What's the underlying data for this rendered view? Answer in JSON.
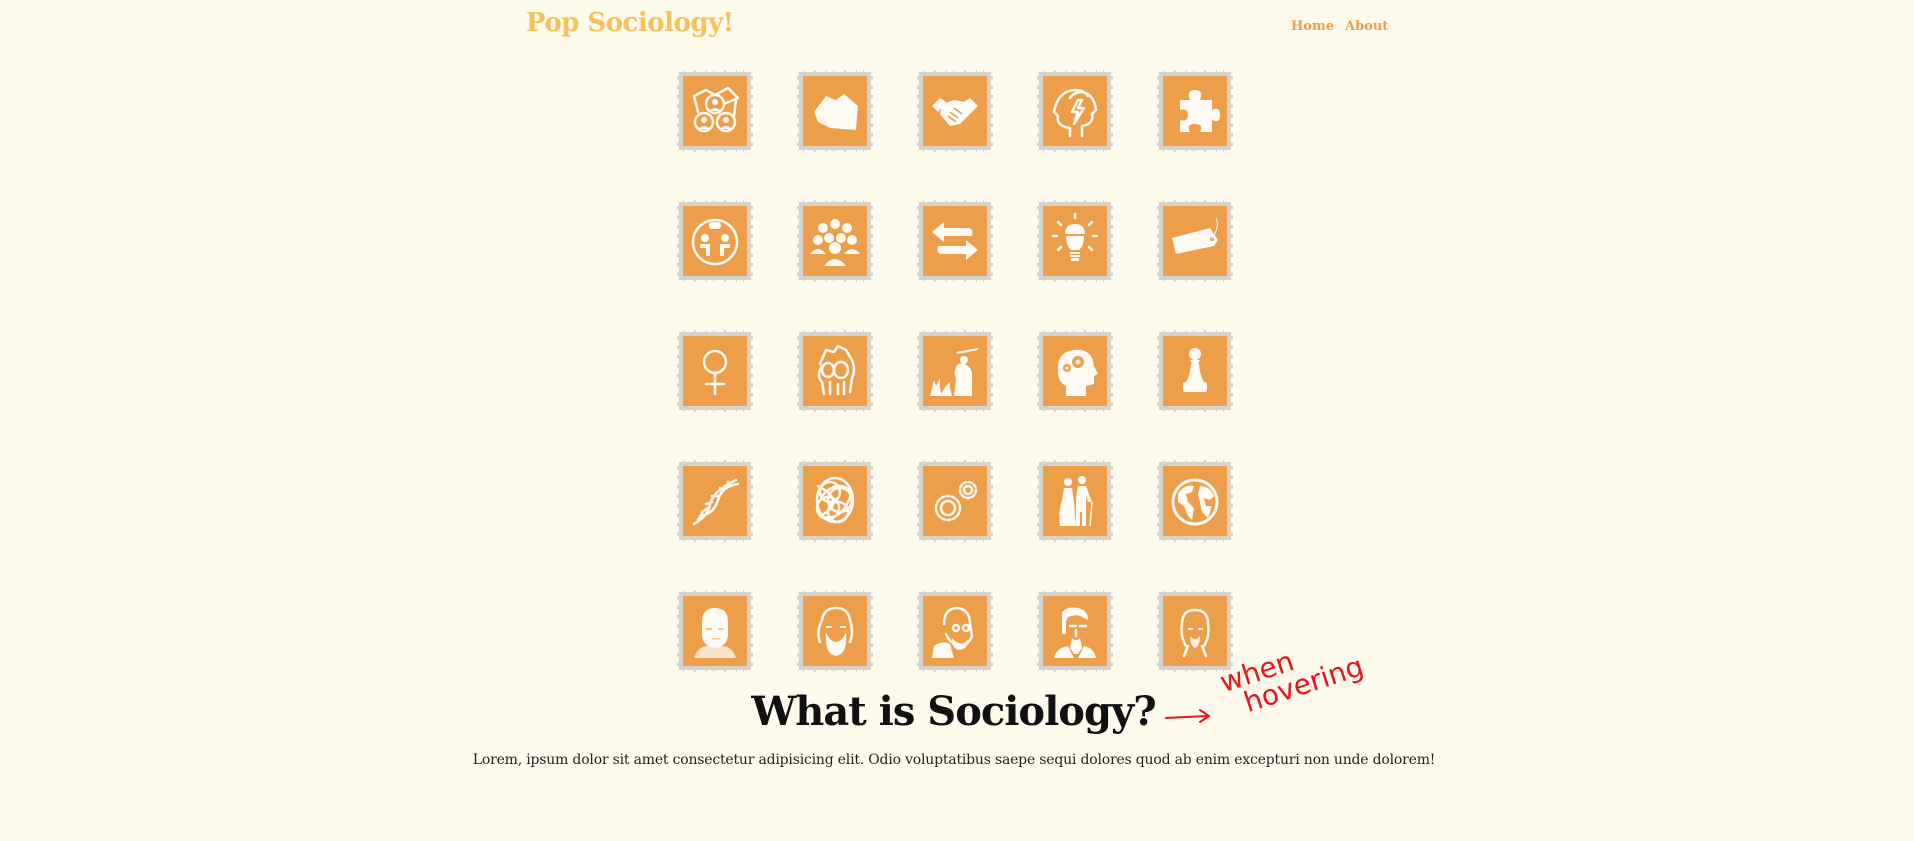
{
  "header": {
    "brand": "Pop Sociology!",
    "nav": [
      {
        "label": "Home"
      },
      {
        "label": "About"
      }
    ]
  },
  "colors": {
    "background": "#fefbec",
    "brand": "#f4c15a",
    "nav_link": "#ec9e4e",
    "stamp_face": "#ec9e4b",
    "stamp_border": "#d6d3cc",
    "annotation": "#e8151b"
  },
  "stamps": [
    {
      "icon": "social-network-icon"
    },
    {
      "icon": "crumpled-paper-icon"
    },
    {
      "icon": "handshake-icon"
    },
    {
      "icon": "head-lightning-icon"
    },
    {
      "icon": "puzzle-piece-icon"
    },
    {
      "icon": "conversation-icon"
    },
    {
      "icon": "crowd-icon"
    },
    {
      "icon": "exchange-arrows-icon"
    },
    {
      "icon": "brain-lightbulb-icon"
    },
    {
      "icon": "price-tag-icon"
    },
    {
      "icon": "venus-symbol-icon"
    },
    {
      "icon": "raised-fist-icon"
    },
    {
      "icon": "police-baton-icon"
    },
    {
      "icon": "head-gears-icon"
    },
    {
      "icon": "chess-pawn-icon"
    },
    {
      "icon": "dna-helix-icon"
    },
    {
      "icon": "tangled-scribble-icon"
    },
    {
      "icon": "gears-icon"
    },
    {
      "icon": "elderly-couple-icon"
    },
    {
      "icon": "globe-icon"
    },
    {
      "icon": "portrait-comte-icon"
    },
    {
      "icon": "portrait-marx-icon"
    },
    {
      "icon": "portrait-durkheim-icon"
    },
    {
      "icon": "portrait-weber-icon"
    },
    {
      "icon": "portrait-spencer-icon"
    }
  ],
  "main": {
    "heading": "What is Sociology?",
    "lead": "Lorem, ipsum dolor sit amet consectetur adipisicing elit. Odio voluptatibus saepe sequi dolores quod ab enim excepturi non unde dolorem!"
  },
  "annotation": {
    "arrow": "→",
    "line1": "when",
    "line2": "hovering"
  }
}
